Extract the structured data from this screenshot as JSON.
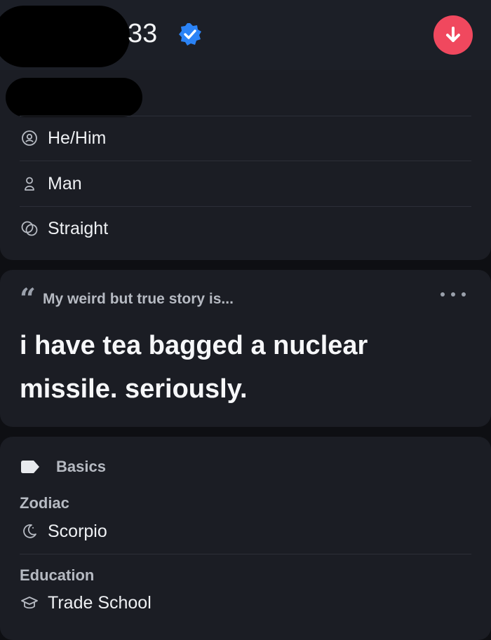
{
  "header": {
    "age": "33",
    "verified_icon": "verified-check-icon",
    "download_icon": "arrow-down-icon",
    "accent_color": "#f0485e",
    "verified_color": "#2b83f6"
  },
  "identity": {
    "items": [
      {
        "icon": "pronouns-icon",
        "label": "He/Him"
      },
      {
        "icon": "person-icon",
        "label": "Man"
      },
      {
        "icon": "orientation-icon",
        "label": "Straight"
      }
    ]
  },
  "prompt": {
    "label": "My weird but true story is...",
    "answer": "i have tea bagged a nuclear missile. seriously."
  },
  "basics": {
    "label": "Basics",
    "fields": [
      {
        "title": "Zodiac",
        "icon": "moon-icon",
        "value": "Scorpio"
      },
      {
        "title": "Education",
        "icon": "graduation-cap-icon",
        "value": "Trade School"
      }
    ]
  }
}
